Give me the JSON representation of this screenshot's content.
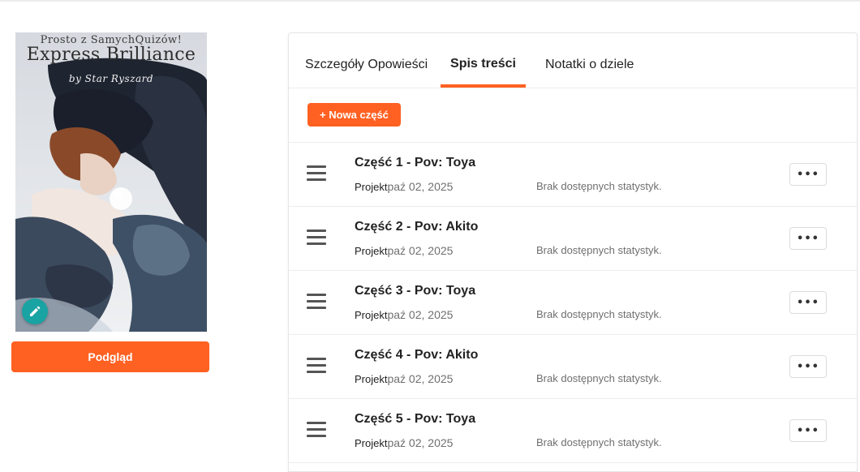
{
  "cover": {
    "tagline": "Prosto z SamychQuizów!",
    "title": "Express Brilliance",
    "author": "by Star Ryszard"
  },
  "left": {
    "preview_label": "Podgląd"
  },
  "tabs": [
    {
      "label": "Szczegóły Opowieści",
      "active": false
    },
    {
      "label": "Spis treści",
      "active": true
    },
    {
      "label": "Notatki o dziele",
      "active": false
    }
  ],
  "toolbar": {
    "new_part_label": "+ Nowa część"
  },
  "parts": [
    {
      "title": "Część 1 - Pov: Toya",
      "status": "Projekt",
      "date": "paź 02, 2025",
      "stats": "Brak dostępnych statystyk."
    },
    {
      "title": "Część 2 - Pov: Akito",
      "status": "Projekt",
      "date": "paź 02, 2025",
      "stats": "Brak dostępnych statystyk."
    },
    {
      "title": "Część 3 - Pov: Toya",
      "status": "Projekt",
      "date": "paź 02, 2025",
      "stats": "Brak dostępnych statystyk."
    },
    {
      "title": "Część 4 - Pov: Akito",
      "status": "Projekt",
      "date": "paź 02, 2025",
      "stats": "Brak dostępnych statystyk."
    },
    {
      "title": "Część 5 - Pov: Toya",
      "status": "Projekt",
      "date": "paź 02, 2025",
      "stats": "Brak dostępnych statystyk."
    }
  ],
  "more_label": "•••",
  "date_separator": " - ",
  "colors": {
    "accent": "#ff6122",
    "edit_fab": "#1aa3a3"
  }
}
